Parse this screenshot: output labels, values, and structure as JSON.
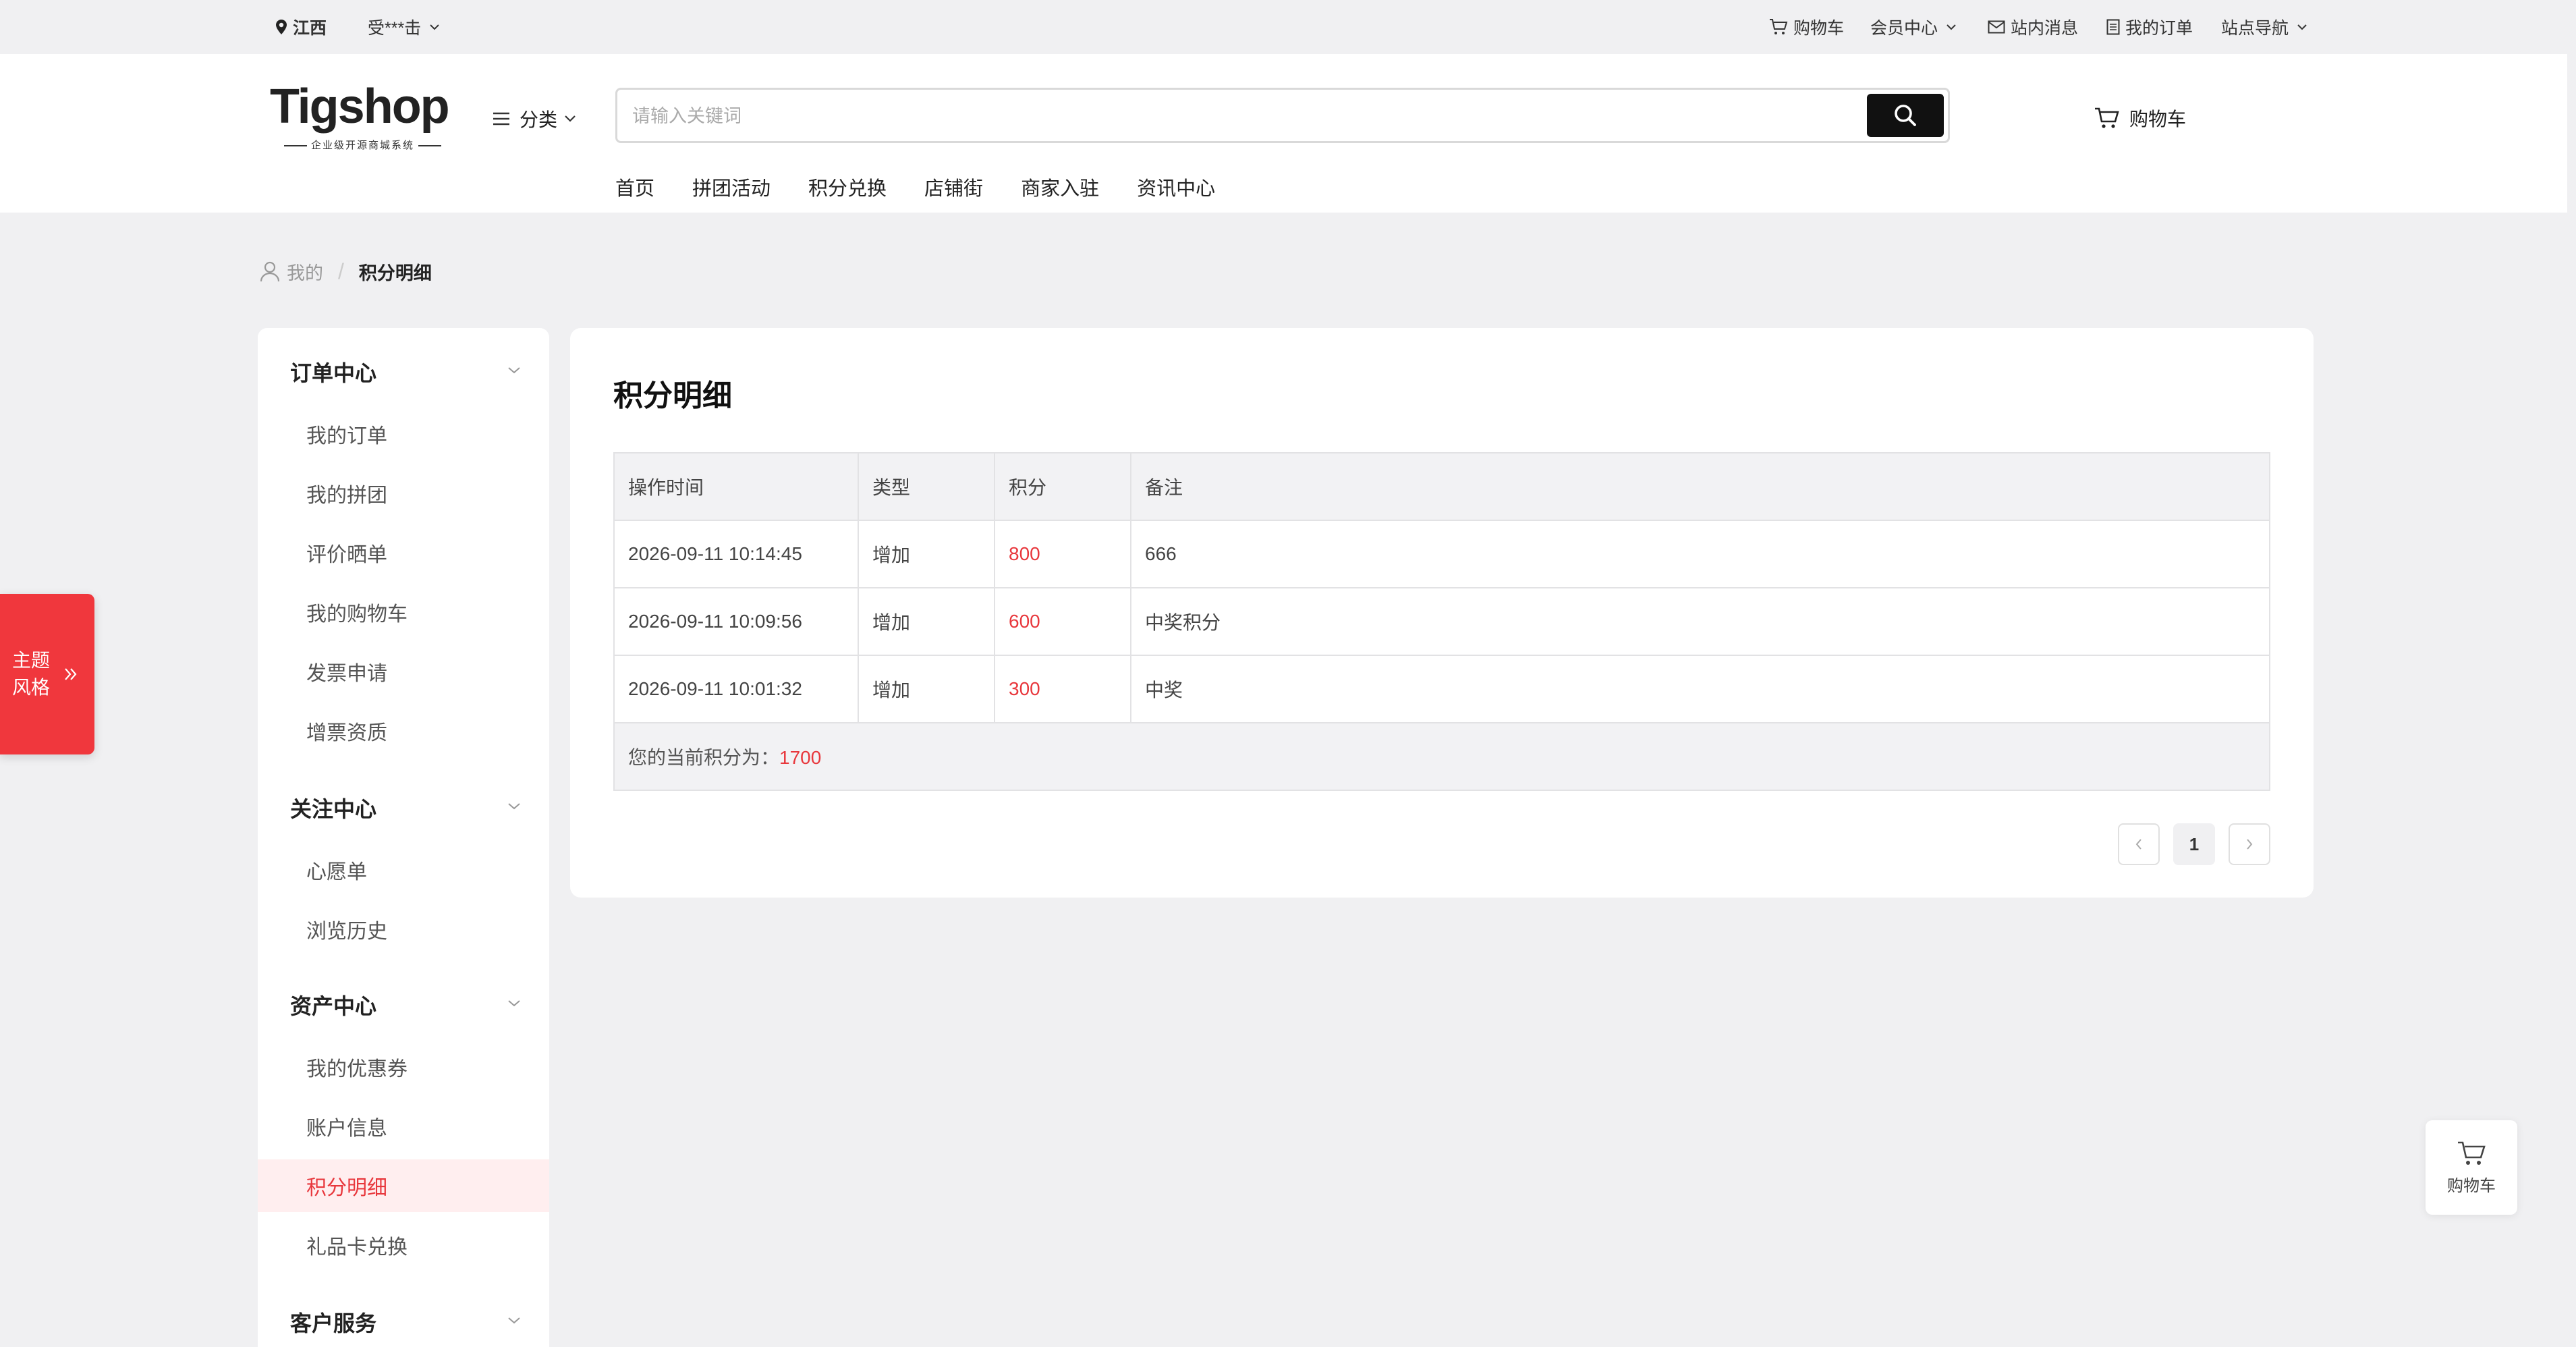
{
  "topbar": {
    "location": "江西",
    "user": "受***击",
    "cart": "购物车",
    "member_center": "会员中心",
    "messages": "站内消息",
    "my_orders": "我的订单",
    "site_nav": "站点导航"
  },
  "header": {
    "logo_text": "Tigshop",
    "logo_sub": "企业级开源商城系统",
    "category": "分类",
    "search_placeholder": "请输入关键词",
    "cart": "购物车"
  },
  "nav": [
    "首页",
    "拼团活动",
    "积分兑换",
    "店铺街",
    "商家入驻",
    "资讯中心"
  ],
  "breadcrumb": {
    "home": "我的",
    "current": "积分明细"
  },
  "sidebar": {
    "groups": [
      {
        "title": "订单中心",
        "items": [
          "我的订单",
          "我的拼团",
          "评价晒单",
          "我的购物车",
          "发票申请",
          "增票资质"
        ]
      },
      {
        "title": "关注中心",
        "items": [
          "心愿单",
          "浏览历史"
        ]
      },
      {
        "title": "资产中心",
        "items": [
          "我的优惠券",
          "账户信息",
          "积分明细",
          "礼品卡兑换"
        ]
      },
      {
        "title": "客户服务",
        "items": []
      }
    ],
    "active_item": "积分明细"
  },
  "main": {
    "title": "积分明细",
    "columns": [
      "操作时间",
      "类型",
      "积分",
      "备注"
    ],
    "rows": [
      {
        "time": "2026-09-11 10:14:45",
        "type": "增加",
        "points": "800",
        "note": "666"
      },
      {
        "time": "2026-09-11 10:09:56",
        "type": "增加",
        "points": "600",
        "note": "中奖积分"
      },
      {
        "time": "2026-09-11 10:01:32",
        "type": "增加",
        "points": "300",
        "note": "中奖"
      }
    ],
    "total_label": "您的当前积分为：",
    "total_value": "1700",
    "pagination": {
      "current_page": "1"
    }
  },
  "floating": {
    "theme_label": "主题风格",
    "cart_label": "购物车"
  },
  "colors": {
    "accent": "#e8373c",
    "page_bg": "#f0f0f2",
    "search_button": "#111111"
  },
  "icons": {
    "location": "map-pin-icon",
    "cart": "cart-icon",
    "message": "mail-icon",
    "order": "document-icon",
    "menu": "hamburger-icon",
    "search": "search-icon",
    "user": "user-icon"
  }
}
